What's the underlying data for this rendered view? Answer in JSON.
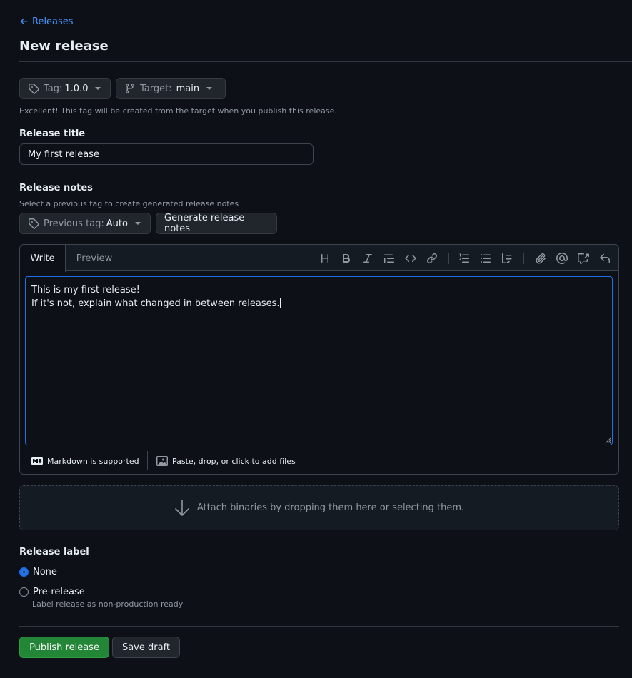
{
  "nav": {
    "back_label": "Releases"
  },
  "page": {
    "title": "New release"
  },
  "tag_picker": {
    "prefix": "Tag:",
    "value": "1.0.0"
  },
  "target_picker": {
    "prefix": "Target:",
    "value": "main"
  },
  "tag_note": "Excellent! This tag will be created from the target when you publish this release.",
  "release_title": {
    "label": "Release title",
    "value": "My first release"
  },
  "release_notes": {
    "label": "Release notes",
    "hint": "Select a previous tag to create generated release notes",
    "previous_tag_prefix": "Previous tag:",
    "previous_tag_value": "Auto",
    "generate_label": "Generate release notes"
  },
  "editor": {
    "tabs": [
      {
        "label": "Write"
      },
      {
        "label": "Preview"
      }
    ],
    "toolbar": [
      "heading-icon",
      "bold-icon",
      "italic-icon",
      "quote-icon",
      "code-icon",
      "link-icon",
      "numbered-list-icon",
      "bulleted-list-icon",
      "task-list-icon",
      "attach-icon",
      "mention-icon",
      "reference-icon",
      "undo-icon"
    ],
    "lines": [
      "This is my first release!",
      "If it's not, explain what changed in between releases."
    ],
    "markdown_label": "Markdown is supported",
    "files_label": "Paste, drop, or click to add files"
  },
  "binaries": {
    "label": "Attach binaries by dropping them here or selecting them."
  },
  "release_label": {
    "heading": "Release label",
    "options": [
      {
        "label": "None",
        "checked": true
      },
      {
        "label": "Pre-release",
        "description": "Label release as non-production ready",
        "checked": false
      }
    ]
  },
  "actions": {
    "publish_label": "Publish release",
    "draft_label": "Save draft"
  },
  "colors": {
    "accent": "#4493f8",
    "primary": "#238636",
    "background": "#0d1117"
  }
}
